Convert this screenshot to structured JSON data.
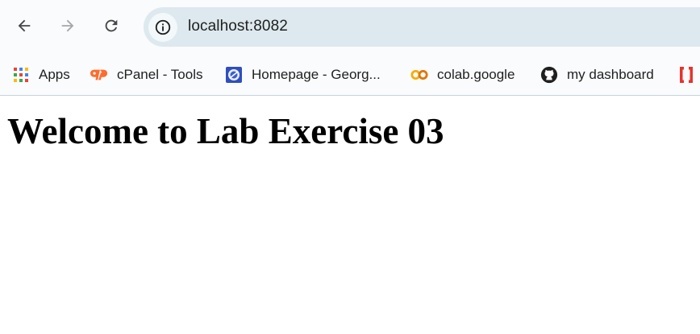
{
  "toolbar": {
    "back_icon": "arrow-left-icon",
    "forward_icon": "arrow-right-icon",
    "reload_icon": "reload-icon",
    "site_info_icon": "info-icon",
    "url": "localhost:8082"
  },
  "bookmarks": [
    {
      "label": "Apps",
      "icon": "apps-grid-icon"
    },
    {
      "label": "cPanel - Tools",
      "icon": "cpanel-icon"
    },
    {
      "label": "Homepage - Georg...",
      "icon": "homepage-favicon-icon"
    },
    {
      "label": "colab.google",
      "icon": "colab-icon"
    },
    {
      "label": "my dashboard",
      "icon": "github-icon"
    },
    {
      "label": "",
      "icon": "bracket-favicon-icon"
    }
  ],
  "page": {
    "heading": "Welcome to Lab Exercise 03"
  },
  "colors": {
    "toolbar_bg": "#f9fbfd",
    "omnibox_bg": "#dde9ee",
    "cpanel": "#ff6c2c",
    "colab": "#f9ab00",
    "extra": "#e8322d"
  }
}
